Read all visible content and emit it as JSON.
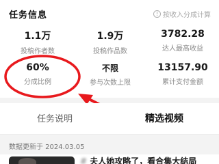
{
  "header": {
    "title": "任务信息",
    "hint": "按收入分成计算",
    "hint_icon": "info-circle-icon"
  },
  "stats": [
    {
      "value": "1.1万",
      "label": "投稿作者数"
    },
    {
      "value": "1.9万",
      "label": "投稿作品数"
    },
    {
      "value": "3782.28",
      "label": "达人最高收益"
    },
    {
      "value": "60%",
      "label": "分成比例"
    },
    {
      "value": "不限",
      "label": "参与次数上限"
    },
    {
      "value": "13157.90",
      "label": "累计支付金额"
    }
  ],
  "annotation": {
    "color": "#e8191d"
  },
  "tabs": [
    {
      "label": "任务说明",
      "active": false
    },
    {
      "label": "精选视频",
      "active": true
    }
  ],
  "update_text": "数据更新于 2024.03.05",
  "videos": [
    {
      "title_hidden": "#",
      "title": "夫人她攻略了，看合集大结局"
    }
  ]
}
